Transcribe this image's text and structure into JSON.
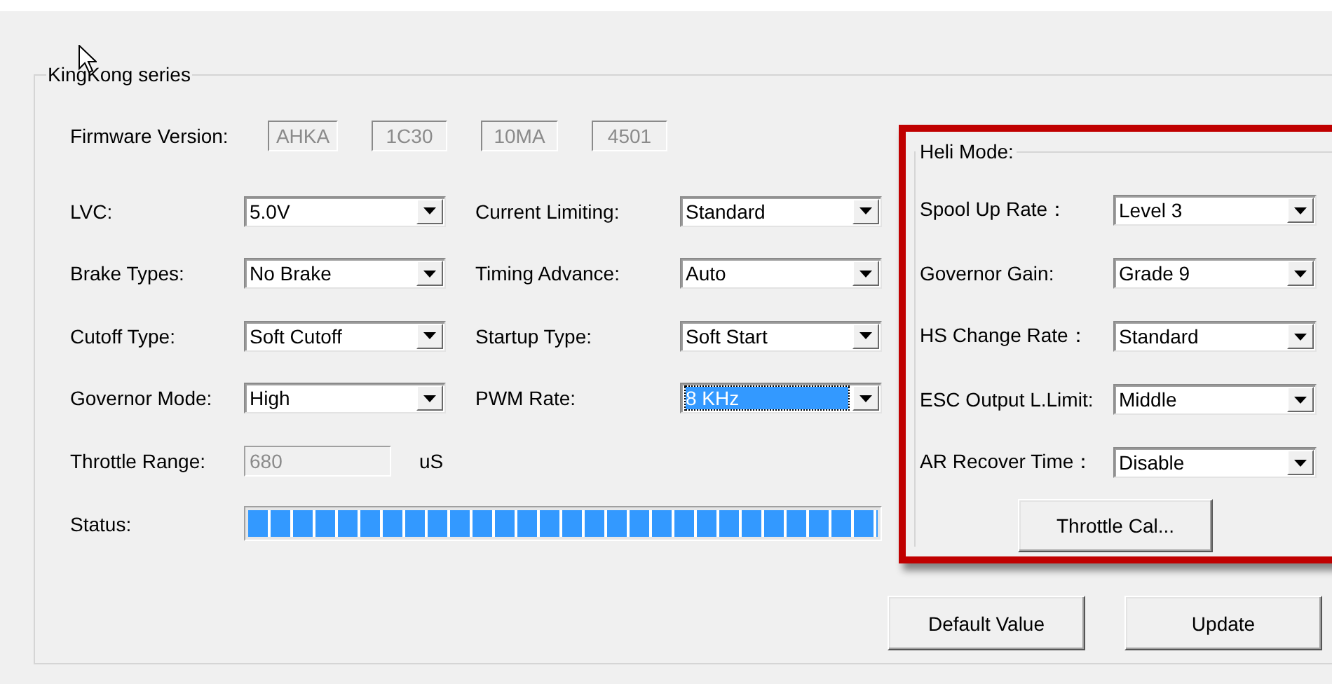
{
  "group": {
    "title": "KingKong series"
  },
  "firmware": {
    "label": "Firmware Version:",
    "values": [
      "AHKA",
      "1C30",
      "10MA",
      "4501"
    ]
  },
  "settings": [
    {
      "label": "LVC:",
      "value": "5.0V",
      "focused": false
    },
    {
      "label": "Current Limiting:",
      "value": "Standard",
      "focused": false
    },
    {
      "label": "Brake Types:",
      "value": "No Brake",
      "focused": false
    },
    {
      "label": "Timing Advance:",
      "value": "Auto",
      "focused": false
    },
    {
      "label": "Cutoff Type:",
      "value": "Soft Cutoff",
      "focused": false
    },
    {
      "label": "Startup Type:",
      "value": "Soft Start",
      "focused": false
    },
    {
      "label": "Governor Mode:",
      "value": "High",
      "focused": false
    },
    {
      "label": "PWM Rate:",
      "value": "8 KHz",
      "focused": true
    }
  ],
  "throttle_range": {
    "label": "Throttle Range:",
    "value": "680",
    "unit": "uS",
    "disabled": true
  },
  "status": {
    "label": "Status:",
    "level": 1.0
  },
  "heli_mode": {
    "title": "Heli Mode:",
    "settings": [
      {
        "label": "Spool Up Rate：",
        "value": "Level 3",
        "focused": false
      },
      {
        "label": "Governor Gain:",
        "value": "Grade 9",
        "focused": false
      },
      {
        "label": "HS Change Rate：",
        "value": "Standard",
        "focused": false
      },
      {
        "label": "ESC Output L.Limit:",
        "value": "Middle",
        "focused": false
      },
      {
        "label": "AR Recover Time：",
        "value": "Disable",
        "focused": false
      }
    ],
    "button": "Throttle Cal..."
  },
  "buttons": [
    "Default Value",
    "Update"
  ]
}
